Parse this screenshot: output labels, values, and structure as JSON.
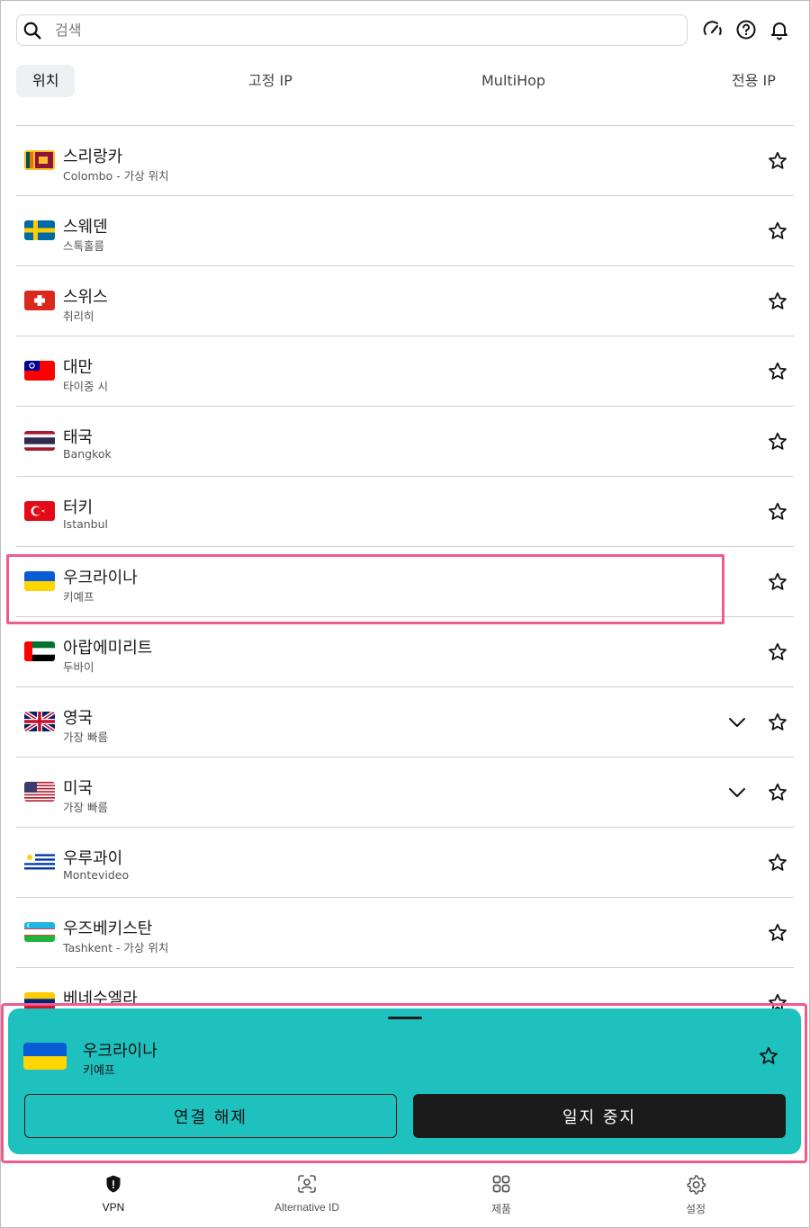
{
  "search": {
    "placeholder": "검색",
    "value": ""
  },
  "top_icons": [
    "speedometer-icon",
    "help-icon",
    "bell-icon"
  ],
  "tabs": [
    {
      "label": "위치",
      "active": true
    },
    {
      "label": "고정 IP",
      "active": false
    },
    {
      "label": "MultiHop",
      "active": false
    },
    {
      "label": "전용 IP",
      "active": false
    }
  ],
  "locations": [
    {
      "name": "스리랑카",
      "sub": "Colombo - 가상 위치",
      "flag": "sri-lanka-flag",
      "expandable": false,
      "highlighted": false
    },
    {
      "name": "스웨덴",
      "sub": "스톡홀름",
      "flag": "sweden-flag",
      "expandable": false,
      "highlighted": false
    },
    {
      "name": "스위스",
      "sub": "취리히",
      "flag": "switzerland-flag",
      "expandable": false,
      "highlighted": false
    },
    {
      "name": "대만",
      "sub": "타이중 시",
      "flag": "taiwan-flag",
      "expandable": false,
      "highlighted": false
    },
    {
      "name": "태국",
      "sub": "Bangkok",
      "flag": "thailand-flag",
      "expandable": false,
      "highlighted": false
    },
    {
      "name": "터키",
      "sub": "Istanbul",
      "flag": "turkey-flag",
      "expandable": false,
      "highlighted": false
    },
    {
      "name": "우크라이나",
      "sub": "키예프",
      "flag": "ukraine-flag",
      "expandable": false,
      "highlighted": true
    },
    {
      "name": "아랍에미리트",
      "sub": "두바이",
      "flag": "uae-flag",
      "expandable": false,
      "highlighted": false
    },
    {
      "name": "영국",
      "sub": "가장 빠름",
      "flag": "uk-flag",
      "expandable": true,
      "highlighted": false
    },
    {
      "name": "미국",
      "sub": "가장 빠름",
      "flag": "usa-flag",
      "expandable": true,
      "highlighted": false
    },
    {
      "name": "우루과이",
      "sub": "Montevideo",
      "flag": "uruguay-flag",
      "expandable": false,
      "highlighted": false
    },
    {
      "name": "우즈베키스탄",
      "sub": "Tashkent - 가상 위치",
      "flag": "uzbekistan-flag",
      "expandable": false,
      "highlighted": false
    },
    {
      "name": "베네수엘라",
      "sub": "",
      "flag": "venezuela-flag",
      "expandable": false,
      "highlighted": false
    }
  ],
  "connection": {
    "name": "우크라이나",
    "sub": "키예프",
    "flag": "ukraine-flag",
    "disconnect_label": "연결 해제",
    "pause_label": "일지 중지",
    "colors": {
      "panel": "#1fc1be",
      "pause_button": "#1b1b1b",
      "highlight": "#ef5b8b"
    }
  },
  "nav": [
    {
      "label": "VPN",
      "icon": "shield-icon",
      "active": true
    },
    {
      "label": "Alternative ID",
      "icon": "alternative-id-icon",
      "active": false
    },
    {
      "label": "제품",
      "icon": "grid-icon",
      "active": false
    },
    {
      "label": "설정",
      "icon": "gear-icon",
      "active": false
    }
  ]
}
